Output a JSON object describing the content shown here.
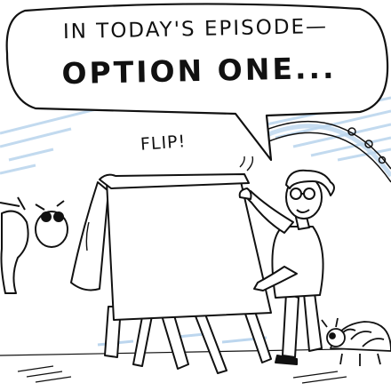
{
  "panel": {
    "speech_line_1": "IN TODAY'S EPISODE—",
    "speech_line_2": "OPTION ONE...",
    "sound_effect": "FLIP!"
  },
  "colors": {
    "ink": "#111111",
    "sky_blue": "#bcd6ee",
    "paper": "#ffffff"
  }
}
